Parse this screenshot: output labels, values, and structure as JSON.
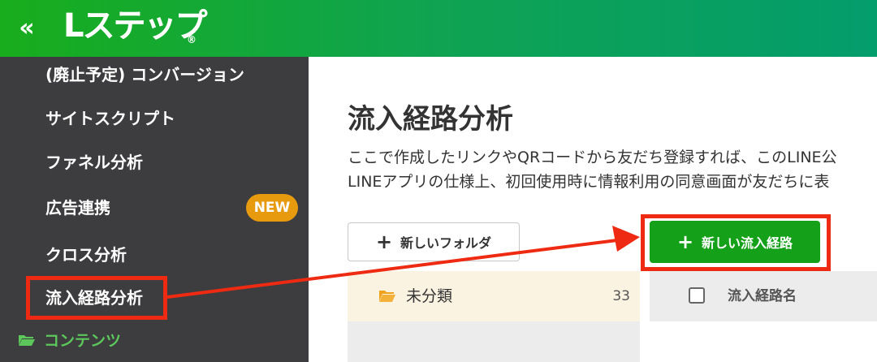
{
  "header": {
    "collapse_icon": "«",
    "logo_text": "Lステップ",
    "logo_mark": "®",
    "colors": {
      "gradient_start": "#18ad1c",
      "gradient_end": "#049d6c"
    }
  },
  "sidebar": {
    "items": [
      {
        "label": "(廃止予定) コンバージョン"
      },
      {
        "label": "サイトスクリプト"
      },
      {
        "label": "ファネル分析"
      },
      {
        "label": "広告連携",
        "badge": "NEW"
      },
      {
        "label": "クロス分析"
      },
      {
        "label": "流入経路分析",
        "highlighted": true
      }
    ],
    "section": {
      "icon": "folder-open-icon",
      "label": "コンテンツ"
    },
    "colors": {
      "background": "#3d3d3f",
      "badge": "#e89a0f",
      "section_text": "#5cc85c"
    }
  },
  "main": {
    "title": "流入経路分析",
    "description_lines": [
      "ここで作成したリンクやQRコードから友だち登録すれば、このLINE公",
      "LINEアプリの仕様上、初回使用時に情報利用の同意画面が友だちに表"
    ],
    "new_folder_button": {
      "icon": "+",
      "label": "新しいフォルダ"
    },
    "new_route_button": {
      "icon": "+",
      "label": "新しい流入経路",
      "color": "#14a019"
    },
    "folders": [
      {
        "icon": "folder-icon",
        "name": "未分類",
        "count": "33"
      }
    ],
    "table": {
      "columns": [
        {
          "label": "流入経路名"
        }
      ]
    }
  },
  "annotation": {
    "color": "#ee2a12"
  }
}
